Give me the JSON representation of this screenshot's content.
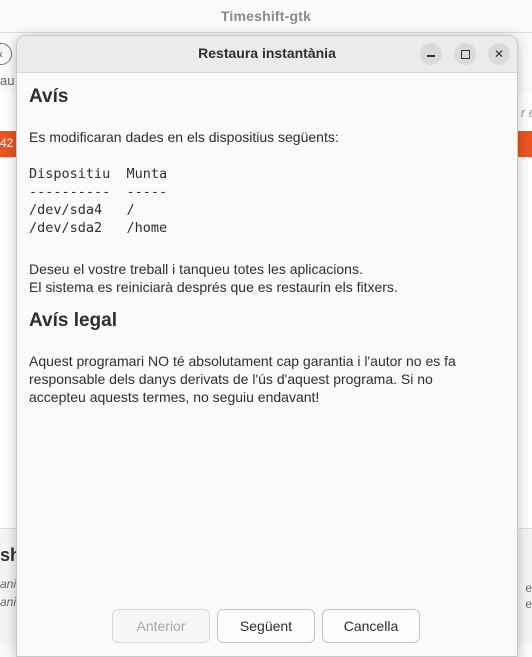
{
  "background_window": {
    "title": "Timeshift-gtk",
    "back_label": "au",
    "search_hint": "r e",
    "orange_text": "42",
    "bottom_title": "sh",
    "bottom_line1": "ani",
    "bottom_line2": "ani",
    "bottom_right1": "e",
    "bottom_right2": "e"
  },
  "dialog": {
    "title": "Restaura instantània",
    "warning": {
      "heading": "Avís",
      "intro": "Es modificaran dades en els dispositius següents:",
      "table_header": "Dispositiu  Munta",
      "table_separator": "----------  -----",
      "rows": [
        "/dev/sda4   /",
        "/dev/sda2   /home"
      ],
      "note_line1": "Deseu el vostre treball i tanqueu totes les aplicacions.",
      "note_line2": "El sistema es reiniciarà després que es restaurin els fitxers."
    },
    "legal": {
      "heading": "Avís legal",
      "line1": "Aquest programari NO té absolutament cap garantia i l'autor no es fa",
      "line2": "responsable dels danys derivats de l'ús d'aquest programa. Si no",
      "line3": "accepteu aquests termes, no seguiu endavant!"
    },
    "buttons": {
      "previous": "Anterior",
      "next": "Següent",
      "cancel": "Cancella"
    }
  }
}
